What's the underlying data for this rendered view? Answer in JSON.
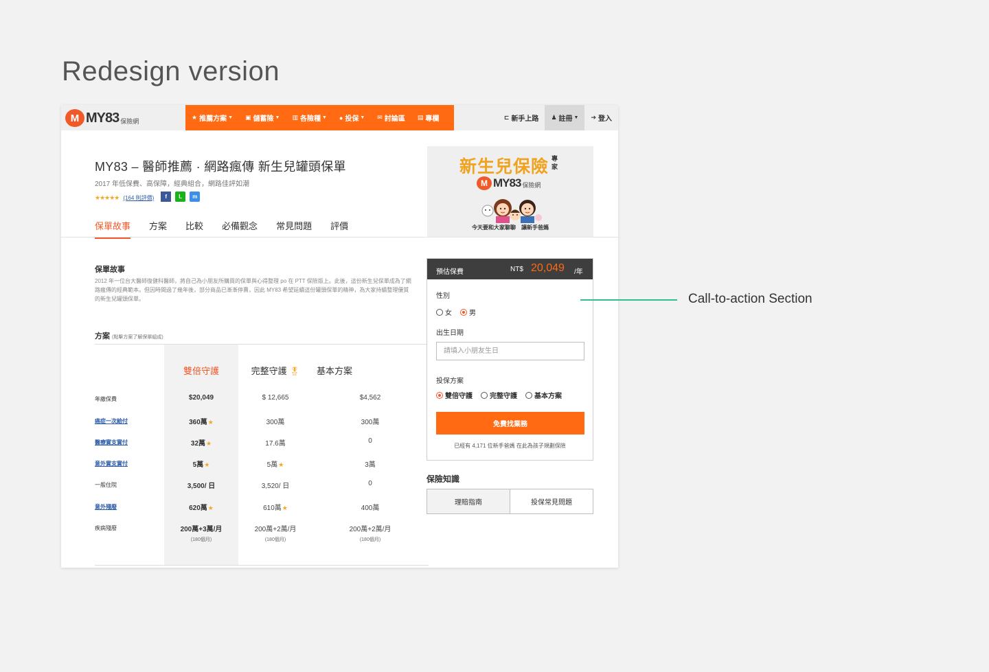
{
  "heading": "Redesign version",
  "nav": {
    "logo_mark": "M",
    "logo_text": "MY83",
    "logo_sub": "保險網",
    "orange_items": [
      {
        "icon": "★",
        "label": "推薦方案",
        "caret": true
      },
      {
        "icon": "▣",
        "label": "儲蓄險",
        "caret": true
      },
      {
        "icon": "▥",
        "label": "各險種",
        "caret": true
      },
      {
        "icon": "●",
        "label": "投保",
        "caret": true
      },
      {
        "icon": "✉",
        "label": "討論區",
        "caret": false
      },
      {
        "icon": "▤",
        "label": "專欄",
        "caret": false
      }
    ],
    "right_items": {
      "newbie": "新手上路",
      "register": "註冊",
      "login": "登入"
    }
  },
  "header": {
    "title": "MY83 – 醫師推薦 · 網路瘋傳 新生兒罐頭保單",
    "subtitle": "2017 年低保費、高保障，經典組合，網路佳評如潮",
    "stars": "★★★★★",
    "review_link": "(164 則評價)",
    "share": {
      "facebook": "f",
      "line": "L",
      "messenger": "m"
    }
  },
  "tabs": [
    "保單故事",
    "方案",
    "比較",
    "必備觀念",
    "常見問題",
    "評價"
  ],
  "banner": {
    "title": "新生兒保險",
    "expert": "專家",
    "logo_text": "MY83",
    "logo_sub": "保險網",
    "caption": "今天要和大家聊聊　讓新手爸媽"
  },
  "story": {
    "heading": "保單故事",
    "body": "2012 年一位台大醫師復健科醫師，將自己為小朋友所購買的保單與心得整理 po 在 PTT 保險版上。此後，這份新生兒保單成為了網路瘋傳的經典範本。但因時間過了幾年後，部分商品已漸漸停賣，因此 MY83 希望延續這份罐頭保單的精神，為大家持續整理優質的新生兒罐頭保單。"
  },
  "plans": {
    "heading": "方案",
    "hint": "(點擊方案了解保單組成)",
    "columns": [
      "雙倍守護",
      "完整守護",
      "基本方案"
    ],
    "rows": [
      {
        "label": "年繳保費",
        "link": false,
        "values": [
          "$20,049",
          "$ 12,665",
          "$4,562"
        ],
        "stars": [
          false,
          false,
          false
        ]
      },
      {
        "label": "癌症一次給付",
        "link": true,
        "values": [
          "360萬",
          "300萬",
          "300萬"
        ],
        "stars": [
          true,
          false,
          false
        ]
      },
      {
        "label": "醫療實支實付",
        "link": true,
        "values": [
          "32萬",
          "17.6萬",
          "0"
        ],
        "stars": [
          true,
          false,
          false
        ]
      },
      {
        "label": "意外實支實付",
        "link": true,
        "values": [
          "5萬",
          "5萬",
          "3萬"
        ],
        "stars": [
          true,
          true,
          false
        ]
      },
      {
        "label": "一般住院",
        "link": false,
        "values": [
          "3,500/ 日",
          "3,520/ 日",
          "0"
        ],
        "stars": [
          false,
          false,
          false
        ]
      },
      {
        "label": "意外殘廢",
        "link": true,
        "values": [
          "620萬",
          "610萬",
          "400萬"
        ],
        "stars": [
          true,
          true,
          false
        ]
      },
      {
        "label": "疾病殘廢",
        "link": false,
        "values": [
          "200萬+3萬/月",
          "200萬+2萬/月",
          "200萬+2萬/月"
        ],
        "stars": [
          false,
          false,
          false
        ],
        "notes": [
          "(180個月)",
          "(180個月)",
          "(180個月)"
        ]
      }
    ]
  },
  "cta": {
    "estimate_label": "預估保費",
    "currency": "NT$",
    "price": "20,049",
    "per": "/年",
    "gender_label": "性別",
    "gender_options": [
      "女",
      "男"
    ],
    "gender_selected": "男",
    "birthday_label": "出生日期",
    "birthday_placeholder": "請填入小朋友生日",
    "plan_label": "投保方案",
    "plan_options": [
      "雙倍守護",
      "完整守護",
      "基本方案"
    ],
    "plan_selected": "雙倍守護",
    "button": "免費找業務",
    "note": "已經有 4,171 位新手爸媽 在此為孩子規劃保險"
  },
  "knowledge": {
    "heading": "保險知識",
    "buttons": [
      "理賠指南",
      "投保常見問題"
    ]
  },
  "annotation": "Call-to-action Section",
  "colors": {
    "accent": "#ff6a13",
    "annotation": "#2fbf8f",
    "banner_title": "#f0a31e"
  }
}
